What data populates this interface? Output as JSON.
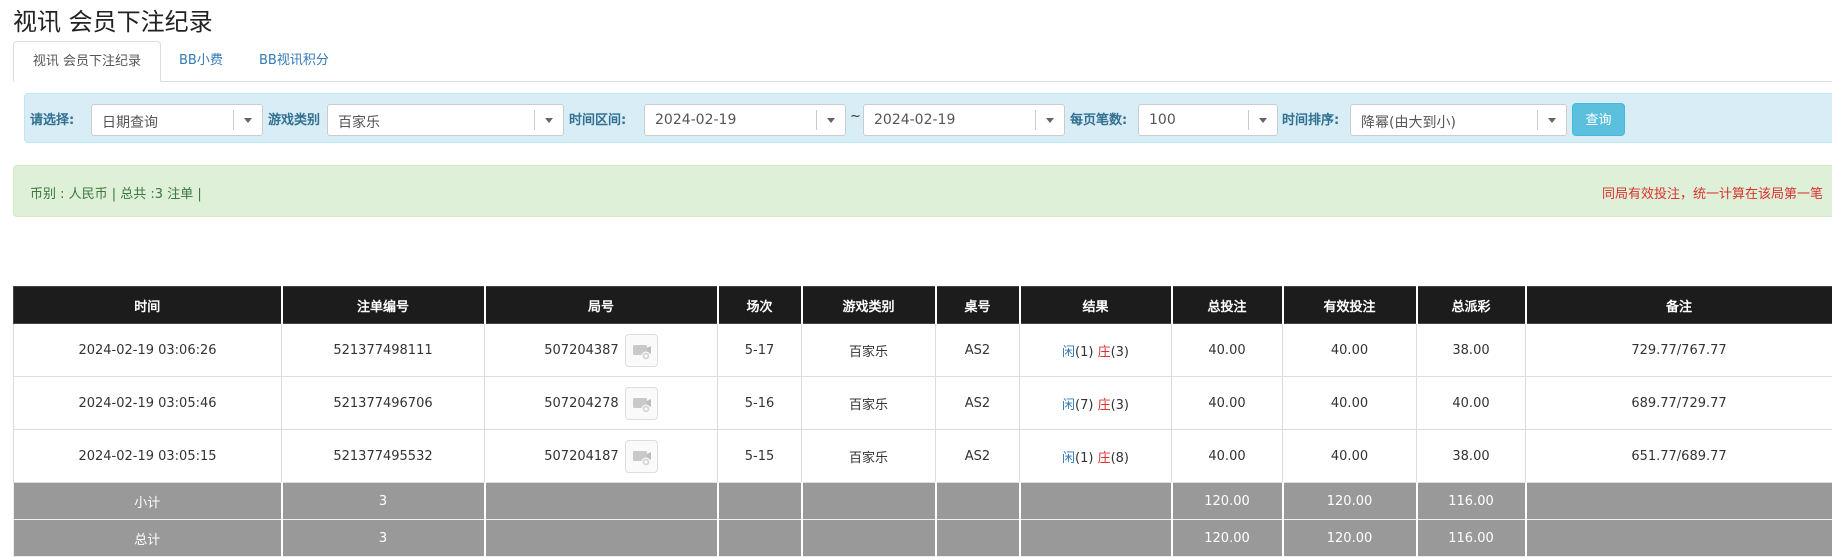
{
  "page_title": "视讯 会员下注纪录",
  "tabs": [
    {
      "label": "视讯 会员下注纪录"
    },
    {
      "label": "BB小费"
    },
    {
      "label": "BB视讯积分"
    }
  ],
  "filters": {
    "select_label": "请选择:",
    "select_value": "日期查询",
    "game_type_label": "游戏类别",
    "game_type_value": "百家乐",
    "time_range_label": "时间区间:",
    "date_from": "2024-02-19",
    "tilde": "~",
    "date_to": "2024-02-19",
    "per_page_label": "每页笔数:",
    "per_page_value": "100",
    "sort_label": "时间排序:",
    "sort_value": "降幂(由大到小)",
    "query_button": "查询"
  },
  "summary": {
    "text": "币别 : 人民币 | 总共 :3 注单 |",
    "notice": "同局有效投注，统一计算在该局第一笔"
  },
  "table": {
    "headers": [
      "时间",
      "注单编号",
      "局号",
      "场次",
      "游戏类别",
      "桌号",
      "结果",
      "总投注",
      "有效投注",
      "总派彩",
      "备注"
    ],
    "rows": [
      {
        "time": "2024-02-19 03:06:26",
        "bet_no": "521377498111",
        "round_no": "507204387",
        "session": "5-17",
        "game": "百家乐",
        "table": "AS2",
        "player_label": "闲",
        "player_pts": "(1)",
        "banker_label": "庄",
        "banker_pts": "(3)",
        "total_bet": "40.00",
        "valid_bet": "40.00",
        "payout": "38.00",
        "remark": "729.77/767.77"
      },
      {
        "time": "2024-02-19 03:05:46",
        "bet_no": "521377496706",
        "round_no": "507204278",
        "session": "5-16",
        "game": "百家乐",
        "table": "AS2",
        "player_label": "闲",
        "player_pts": "(7)",
        "banker_label": "庄",
        "banker_pts": "(3)",
        "total_bet": "40.00",
        "valid_bet": "40.00",
        "payout": "40.00",
        "remark": "689.77/729.77"
      },
      {
        "time": "2024-02-19 03:05:15",
        "bet_no": "521377495532",
        "round_no": "507204187",
        "session": "5-15",
        "game": "百家乐",
        "table": "AS2",
        "player_label": "闲",
        "player_pts": "(1)",
        "banker_label": "庄",
        "banker_pts": "(8)",
        "total_bet": "40.00",
        "valid_bet": "40.00",
        "payout": "38.00",
        "remark": "651.77/689.77"
      }
    ],
    "subtotal": {
      "label": "小计",
      "count": "3",
      "total_bet": "120.00",
      "valid_bet": "120.00",
      "payout": "116.00"
    },
    "total": {
      "label": "总计",
      "count": "3",
      "total_bet": "120.00",
      "valid_bet": "120.00",
      "payout": "116.00"
    }
  }
}
